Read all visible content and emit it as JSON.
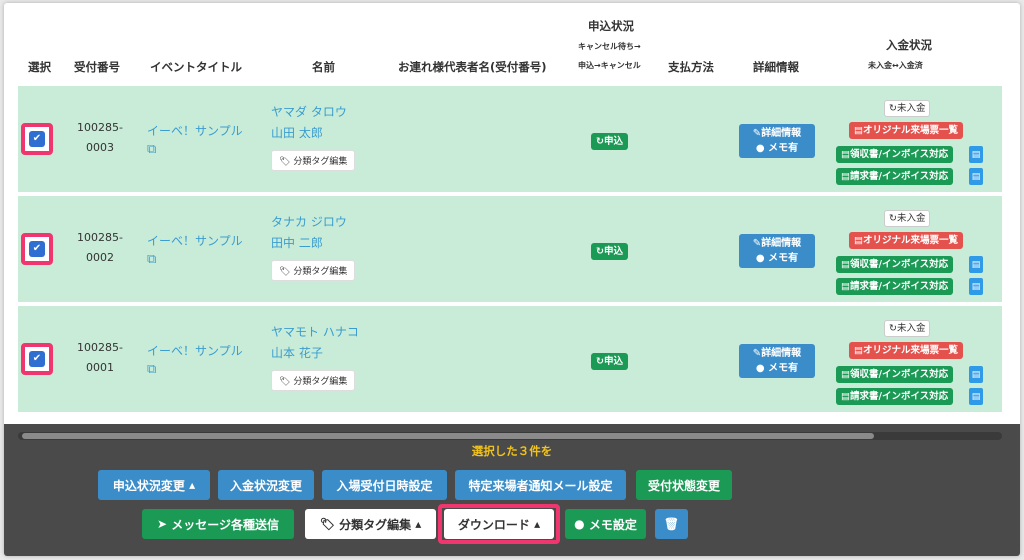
{
  "header": {
    "select": "選択",
    "receipt_no": "受付番号",
    "event_title": "イベントタイトル",
    "name": "名前",
    "companion": "お連れ様代表者名(受付番号)",
    "app_status": "申込状況",
    "app_status_sub1": "キャンセル待ち→",
    "app_status_sub2": "申込→キャンセル",
    "payment_method": "支払方法",
    "details": "詳細情報",
    "payment_status": "入金状況",
    "payment_status_sub": "未入金↔入金済"
  },
  "rows": [
    {
      "checked": true,
      "receipt_no_1": "100285-",
      "receipt_no_2": "0003",
      "event_title": "イーベ！サンプル",
      "name_kana": "ヤマダ タロウ",
      "name_kanji": "山田 太郎",
      "tag_button": "分類タグ編集",
      "status": "申込",
      "detail_button": "詳細情報",
      "memo": "メモ有",
      "unpaid": "未入金",
      "original_ticket": "オリジナル来場票一覧",
      "receipt_invoice": "領収書/インボイス対応",
      "bill_invoice": "請求書/インボイス対応"
    },
    {
      "checked": true,
      "receipt_no_1": "100285-",
      "receipt_no_2": "0002",
      "event_title": "イーベ！サンプル",
      "name_kana": "タナカ ジロウ",
      "name_kanji": "田中 二郎",
      "tag_button": "分類タグ編集",
      "status": "申込",
      "detail_button": "詳細情報",
      "memo": "メモ有",
      "unpaid": "未入金",
      "original_ticket": "オリジナル来場票一覧",
      "receipt_invoice": "領収書/インボイス対応",
      "bill_invoice": "請求書/インボイス対応"
    },
    {
      "checked": true,
      "receipt_no_1": "100285-",
      "receipt_no_2": "0001",
      "event_title": "イーベ！サンプル",
      "name_kana": "ヤマモト ハナコ",
      "name_kanji": "山本 花子",
      "tag_button": "分類タグ編集",
      "status": "申込",
      "detail_button": "詳細情報",
      "memo": "メモ有",
      "unpaid": "未入金",
      "original_ticket": "オリジナル来場票一覧",
      "receipt_invoice": "領収書/インボイス対応",
      "bill_invoice": "請求書/インボイス対応"
    }
  ],
  "bulk": {
    "selected_text": "選択した３件を",
    "change_app_status": "申込状況変更",
    "change_payment_status": "入金状況変更",
    "set_entry_datetime": "入場受付日時設定",
    "specific_mail": "特定来場者通知メール設定",
    "change_reception": "受付状態変更",
    "send_messages": "メッセージ各種送信",
    "edit_tags": "分類タグ編集",
    "download": "ダウンロード",
    "memo_settings": "メモ設定"
  },
  "icons": {
    "check": "check-icon",
    "external_link": "external-link-icon",
    "tag": "tag-icon",
    "refresh": "refresh-icon",
    "edit": "edit-icon",
    "comment": "comment-icon",
    "document": "document-icon",
    "caret": "caret-up-icon",
    "send": "send-icon",
    "trash": "trash-icon"
  },
  "colors": {
    "row_bg": "#c8ecd8",
    "highlight": "#f0366f",
    "green": "#1a9a54",
    "blue": "#3a8dc8",
    "red": "#e4524e",
    "bar_bg": "#4a4a4a",
    "selected_text": "#f1c21b"
  }
}
